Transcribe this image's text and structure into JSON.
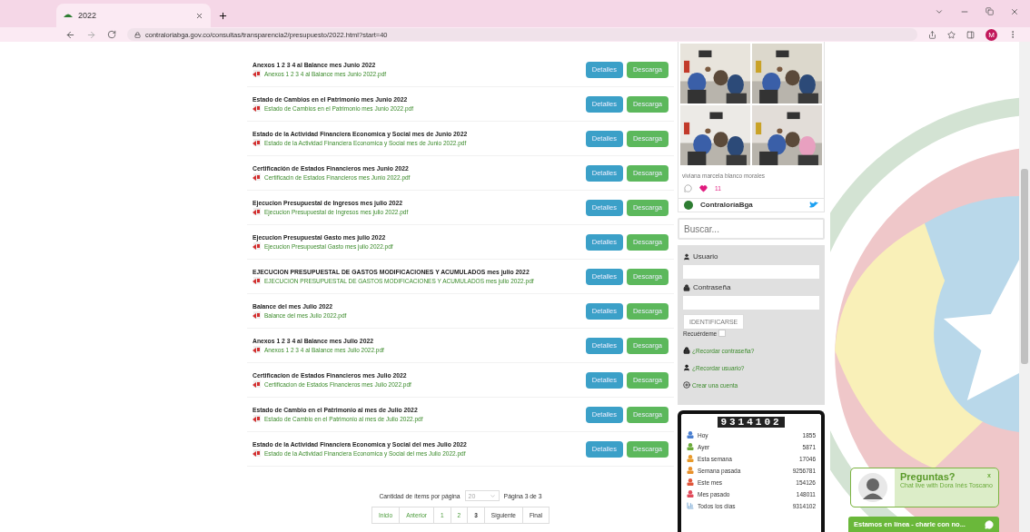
{
  "browser": {
    "tab_title": "2022",
    "url": "contraloriabga.gov.co/consultas/transparencia2/presupuesto/2022.html?start=40",
    "profile_initial": "M"
  },
  "documents": [
    {
      "title": "Anexos 1 2 3 4 al Balance mes Junio 2022",
      "file": "Anexos 1 2 3 4 al Balance mes Junio 2022.pdf"
    },
    {
      "title": "Estado de Cambios en el Patrimonio mes Junio 2022",
      "file": "Estado de Cambios en el Patrimonio mes Junio 2022.pdf"
    },
    {
      "title": "Estado de la Actividad Financiera Economica y Social mes de Junio 2022",
      "file": "Estado de la Actividad Financiera Economica y Social mes de Junio 2022.pdf"
    },
    {
      "title": "Certificación de Estados Financieros mes Junio 2022",
      "file": "Certificacin de Estados Financieros mes Junio 2022.pdf"
    },
    {
      "title": "Ejecucion Presupuestal de Ingresos mes julio 2022",
      "file": "Ejecucion Presupuestal de Ingresos mes julio 2022.pdf"
    },
    {
      "title": "Ejecucion Presupuestal Gasto mes julio 2022",
      "file": "Ejecucion Presupuestal Gasto mes julio 2022.pdf"
    },
    {
      "title": "EJECUCION PRESUPUESTAL DE GASTOS MODIFICACIONES Y ACUMULADOS mes julio 2022",
      "file": "EJECUCION PRESUPUESTAL DE GASTOS MODIFICACIONES Y ACUMULADOS mes julio 2022.pdf"
    },
    {
      "title": "Balance del mes Julio 2022",
      "file": "Balance del mes Julio 2022.pdf"
    },
    {
      "title": "Anexos 1 2 3 4 al Balance mes Julio 2022",
      "file": "Anexos 1 2 3 4 al Balance mes Julio 2022.pdf"
    },
    {
      "title": "Certificacion de Estados Financieros mes Julio 2022",
      "file": "Certificacion de Estados Financieros mes Julio 2022.pdf"
    },
    {
      "title": "Estado de Cambio en el Patrimonio al mes de Julio 2022",
      "file": "Estado de Cambio en el Patrimonio al mes de Julio 2022.pdf"
    },
    {
      "title": "Estado de la Actividad Financiera Economica y Social del mes Julio 2022",
      "file": "Estado de la Actividad Financiera Economica y Social del mes Julio 2022.pdf"
    }
  ],
  "row_buttons": [
    {
      "details": "Detalles",
      "download": "Descarga"
    },
    {
      "details": "Detalles",
      "download": "Descarga"
    },
    {
      "details": "Detalles",
      "download": "Descarga"
    },
    {
      "details": "Detalles",
      "download": "Descarga"
    },
    {
      "details": "Detalles",
      "download": "Descarga"
    },
    {
      "details": "Detalles",
      "download": "Descarga"
    },
    {
      "details": "Detalles",
      "download": "Descarga"
    },
    {
      "details": "Detalles",
      "download": "Descarga"
    },
    {
      "details": "Detalles",
      "download": "Descarga"
    },
    {
      "details": "Detalles",
      "download": "Descarga"
    },
    {
      "details": "Detalles",
      "download": "Descarga"
    },
    {
      "details": "Detalles",
      "download": "Descarga"
    }
  ],
  "pagination": {
    "items_label": "Cantidad de ítems por página",
    "per_page": "20",
    "page_info": "Página 3 de 3",
    "links": [
      {
        "label": "Inicio",
        "selected": false,
        "disabled": false
      },
      {
        "label": "Anterior",
        "selected": false,
        "disabled": false
      },
      {
        "label": "1",
        "selected": false,
        "disabled": false
      },
      {
        "label": "2",
        "selected": false,
        "disabled": false
      },
      {
        "label": "3",
        "selected": true,
        "disabled": false
      },
      {
        "label": "Siguiente",
        "selected": false,
        "disabled": true
      },
      {
        "label": "Final",
        "selected": false,
        "disabled": true
      }
    ]
  },
  "feed": {
    "caption": "viviana marcela blanco morales",
    "likes": "11",
    "account": "ContraloríaBga"
  },
  "search": {
    "placeholder": "Buscar..."
  },
  "login": {
    "user_label": "Usuario",
    "password_label": "Contraseña",
    "submit": "IDENTIFICARSE",
    "remember": {
      "label": "Recuérdeme",
      "checked": false
    },
    "links": [
      {
        "kind": "lock",
        "label": "¿Recordar contraseña?"
      },
      {
        "kind": "user",
        "label": "¿Recordar usuario?"
      },
      {
        "kind": "plus",
        "label": "Crear una cuenta"
      }
    ]
  },
  "counter": {
    "total": "9314102",
    "rows": [
      {
        "kind": "person",
        "color": "#4a7fd0",
        "label": "Hoy",
        "value": "1855"
      },
      {
        "kind": "person",
        "color": "#6aaa3a",
        "label": "Ayer",
        "value": "5871"
      },
      {
        "kind": "person",
        "color": "#e89a2a",
        "label": "Esta semana",
        "value": "17046"
      },
      {
        "kind": "person",
        "color": "#e8902a",
        "label": "Semana pasada",
        "value": "9256781"
      },
      {
        "kind": "person",
        "color": "#e0553a",
        "label": "Este mes",
        "value": "154126"
      },
      {
        "kind": "person",
        "color": "#e04a5a",
        "label": "Mes pasado",
        "value": "148011"
      },
      {
        "kind": "chart",
        "label": "Todos los días",
        "value": "9314102"
      }
    ]
  },
  "chat": {
    "title": "Preguntas?",
    "subtitle": "Chat live with Dora Inés Toscano",
    "close": "x",
    "bar": "Estamos en línea - charle con no..."
  }
}
